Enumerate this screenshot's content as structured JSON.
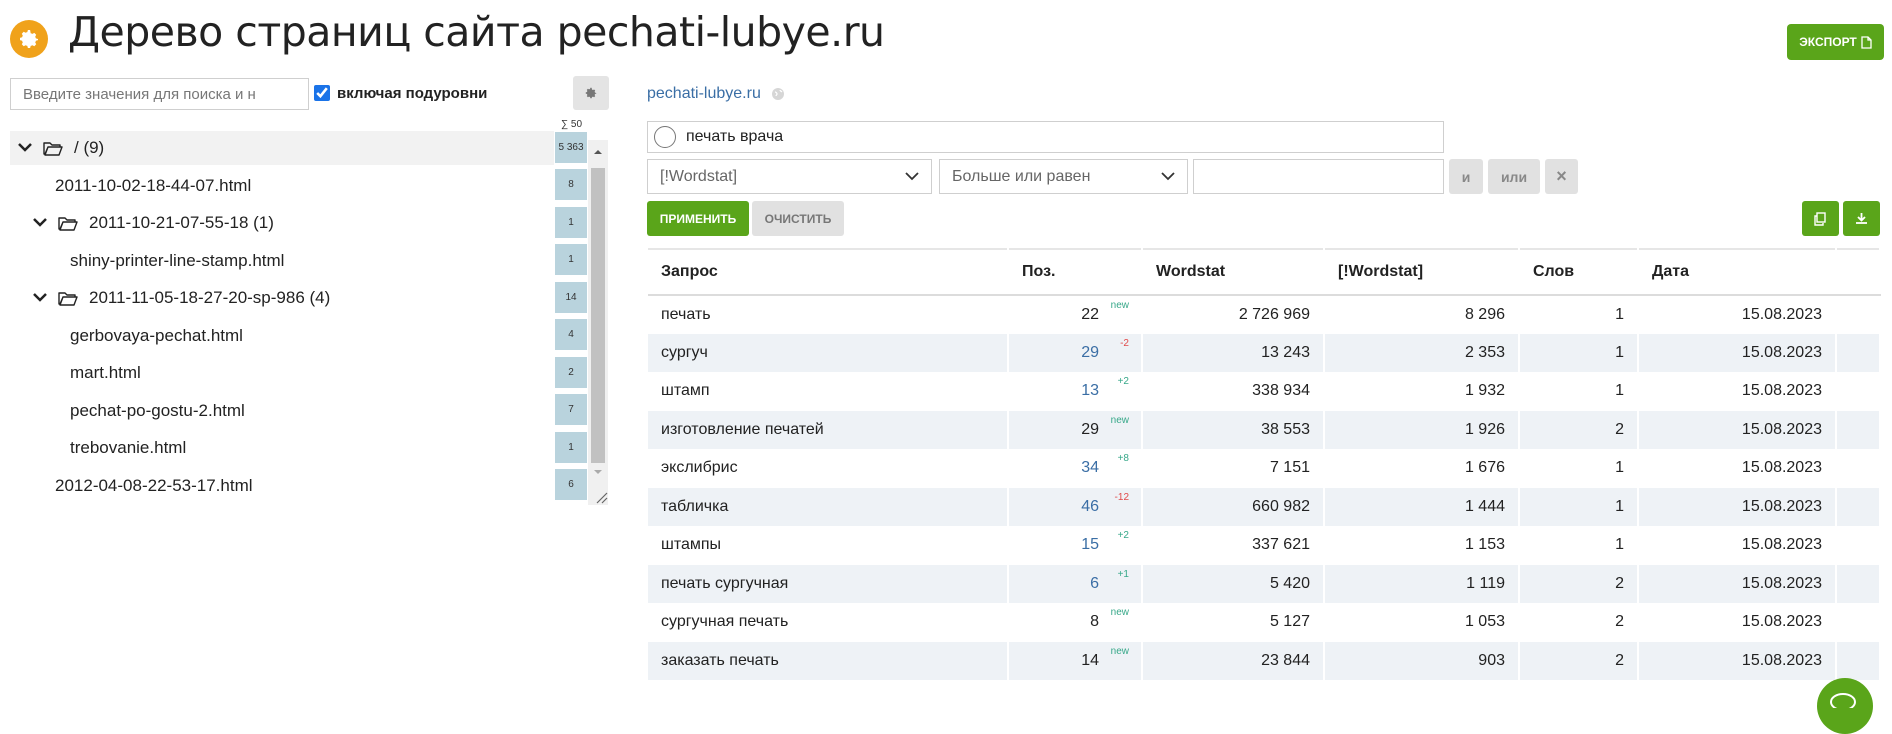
{
  "header": {
    "title": "Дерево страниц сайта pechati-lubye.ru",
    "export_label": "ЭКСПОРТ"
  },
  "sidebar": {
    "search_placeholder": "Введите значения для поиска и н",
    "include_sublevels_label": "включая подуровни",
    "include_sublevels_checked": true,
    "sum_label": "∑ 50",
    "tree": [
      {
        "label": "/ (9)",
        "count": "5 363",
        "level": 0,
        "folder": true,
        "expanded": true
      },
      {
        "label": "2011-10-02-18-44-07.html",
        "count": "8",
        "level": 1,
        "folder": false
      },
      {
        "label": "2011-10-21-07-55-18 (1)",
        "count": "1",
        "level": 1,
        "folder": true,
        "expanded": true
      },
      {
        "label": "shiny-printer-line-stamp.html",
        "count": "1",
        "level": 2,
        "folder": false
      },
      {
        "label": "2011-11-05-18-27-20-sp-986 (4)",
        "count": "14",
        "level": 1,
        "folder": true,
        "expanded": true
      },
      {
        "label": "gerbovaya-pechat.html",
        "count": "4",
        "level": 2,
        "folder": false
      },
      {
        "label": "mart.html",
        "count": "2",
        "level": 2,
        "folder": false
      },
      {
        "label": "pechat-po-gostu-2.html",
        "count": "7",
        "level": 2,
        "folder": false
      },
      {
        "label": "trebovanie.html",
        "count": "1",
        "level": 2,
        "folder": false
      },
      {
        "label": "2012-04-08-22-53-17.html",
        "count": "6",
        "level": 1,
        "folder": false
      }
    ]
  },
  "main": {
    "site_link": "pechati-lubye.ru",
    "search_value": "печать врача",
    "filter": {
      "field_select": "[!Wordstat]",
      "operator_select": "Больше или равен",
      "value": "",
      "and_label": "и",
      "or_label": "или",
      "remove_label": "×"
    },
    "apply_label": "ПРИМЕНИТЬ",
    "clear_label": "ОЧИСТИТЬ",
    "table": {
      "headers": [
        "Запрос",
        "Поз.",
        "Wordstat",
        "[!Wordstat]",
        "Слов",
        "Дата"
      ],
      "rows": [
        {
          "query": "печать",
          "pos": "22",
          "delta": "new",
          "wordstat": "2 726 969",
          "exact": "8 296",
          "words": "1",
          "date": "15.08.2023"
        },
        {
          "query": "сургуч",
          "pos": "29",
          "delta": "-2",
          "wordstat": "13 243",
          "exact": "2 353",
          "words": "1",
          "date": "15.08.2023"
        },
        {
          "query": "штамп",
          "pos": "13",
          "delta": "+2",
          "wordstat": "338 934",
          "exact": "1 932",
          "words": "1",
          "date": "15.08.2023"
        },
        {
          "query": "изготовление печатей",
          "pos": "29",
          "delta": "new",
          "wordstat": "38 553",
          "exact": "1 926",
          "words": "2",
          "date": "15.08.2023"
        },
        {
          "query": "экслибрис",
          "pos": "34",
          "delta": "+8",
          "wordstat": "7 151",
          "exact": "1 676",
          "words": "1",
          "date": "15.08.2023"
        },
        {
          "query": "табличка",
          "pos": "46",
          "delta": "-12",
          "wordstat": "660 982",
          "exact": "1 444",
          "words": "1",
          "date": "15.08.2023"
        },
        {
          "query": "штампы",
          "pos": "15",
          "delta": "+2",
          "wordstat": "337 621",
          "exact": "1 153",
          "words": "1",
          "date": "15.08.2023"
        },
        {
          "query": "печать сургучная",
          "pos": "6",
          "delta": "+1",
          "wordstat": "5 420",
          "exact": "1 119",
          "words": "2",
          "date": "15.08.2023"
        },
        {
          "query": "сургучная печать",
          "pos": "8",
          "delta": "new",
          "wordstat": "5 127",
          "exact": "1 053",
          "words": "2",
          "date": "15.08.2023"
        },
        {
          "query": "заказать печать",
          "pos": "14",
          "delta": "new",
          "wordstat": "23 844",
          "exact": "903",
          "words": "2",
          "date": "15.08.2023"
        }
      ]
    }
  },
  "colors": {
    "accent_green": "#5aa51a",
    "logo_orange": "#f0a21b",
    "link_blue": "#3a6ea5",
    "delta_up": "#37a889",
    "delta_down": "#e14b4b",
    "count_cell": "#b9d3dd"
  },
  "icons": [
    "gear-icon",
    "file-icon",
    "chevron-down-icon",
    "folder-open-icon",
    "globe-icon",
    "search-icon",
    "copy-icon",
    "download-icon",
    "chat-icon"
  ]
}
